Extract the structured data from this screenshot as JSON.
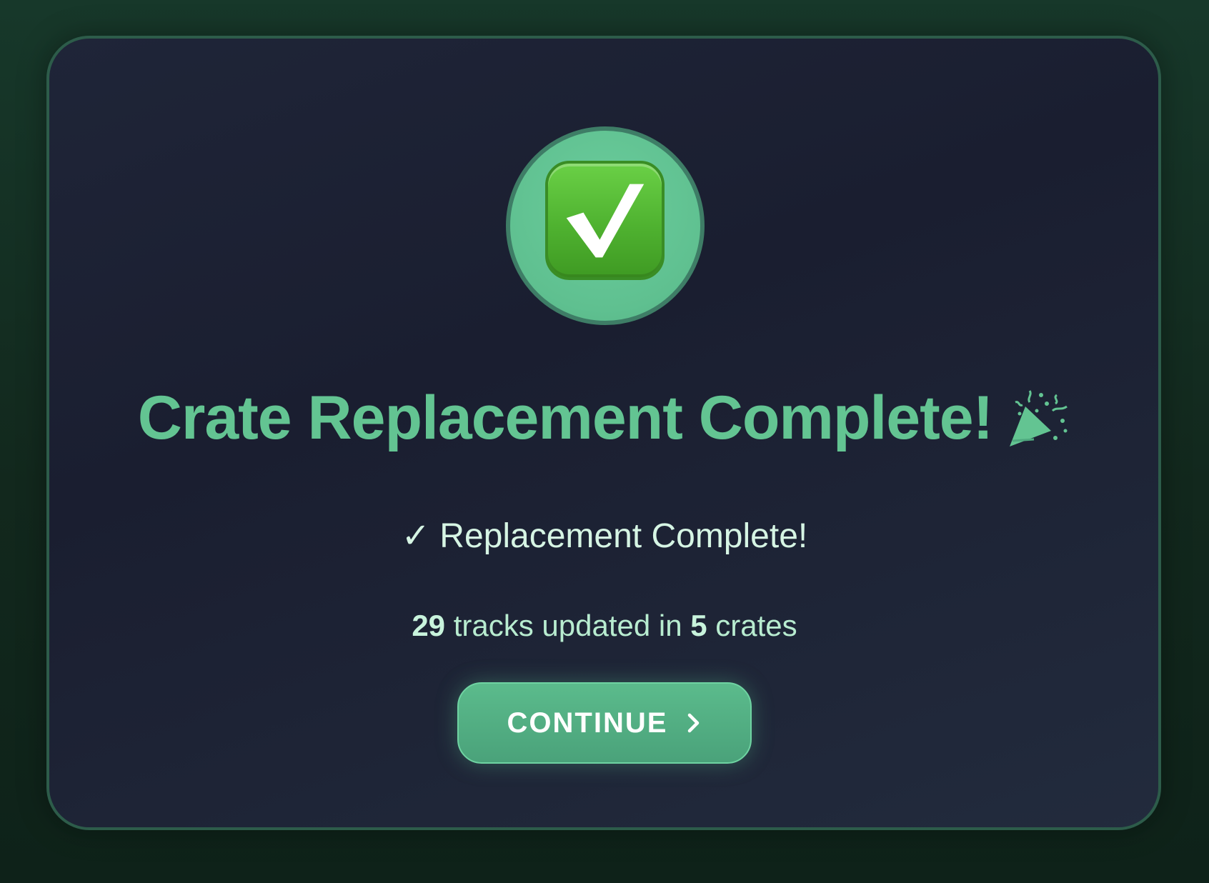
{
  "dialog": {
    "title": "Crate Replacement Complete!",
    "title_icon": "party-popper-icon",
    "badge_icon": "check-box-icon",
    "status_text": "✓ Replacement Complete!",
    "summary": {
      "tracks_count": "29",
      "tracks_text": "tracks updated in",
      "crates_count": "5",
      "crates_text": "crates"
    },
    "continue_label": "CONTINUE",
    "continue_icon": "chevron-right-icon"
  },
  "colors": {
    "accent_green": "#63c492",
    "badge_green": "#5fc090",
    "button_green": "#4fa97f",
    "card_background": "#1f2538",
    "page_background": "#15321f"
  }
}
